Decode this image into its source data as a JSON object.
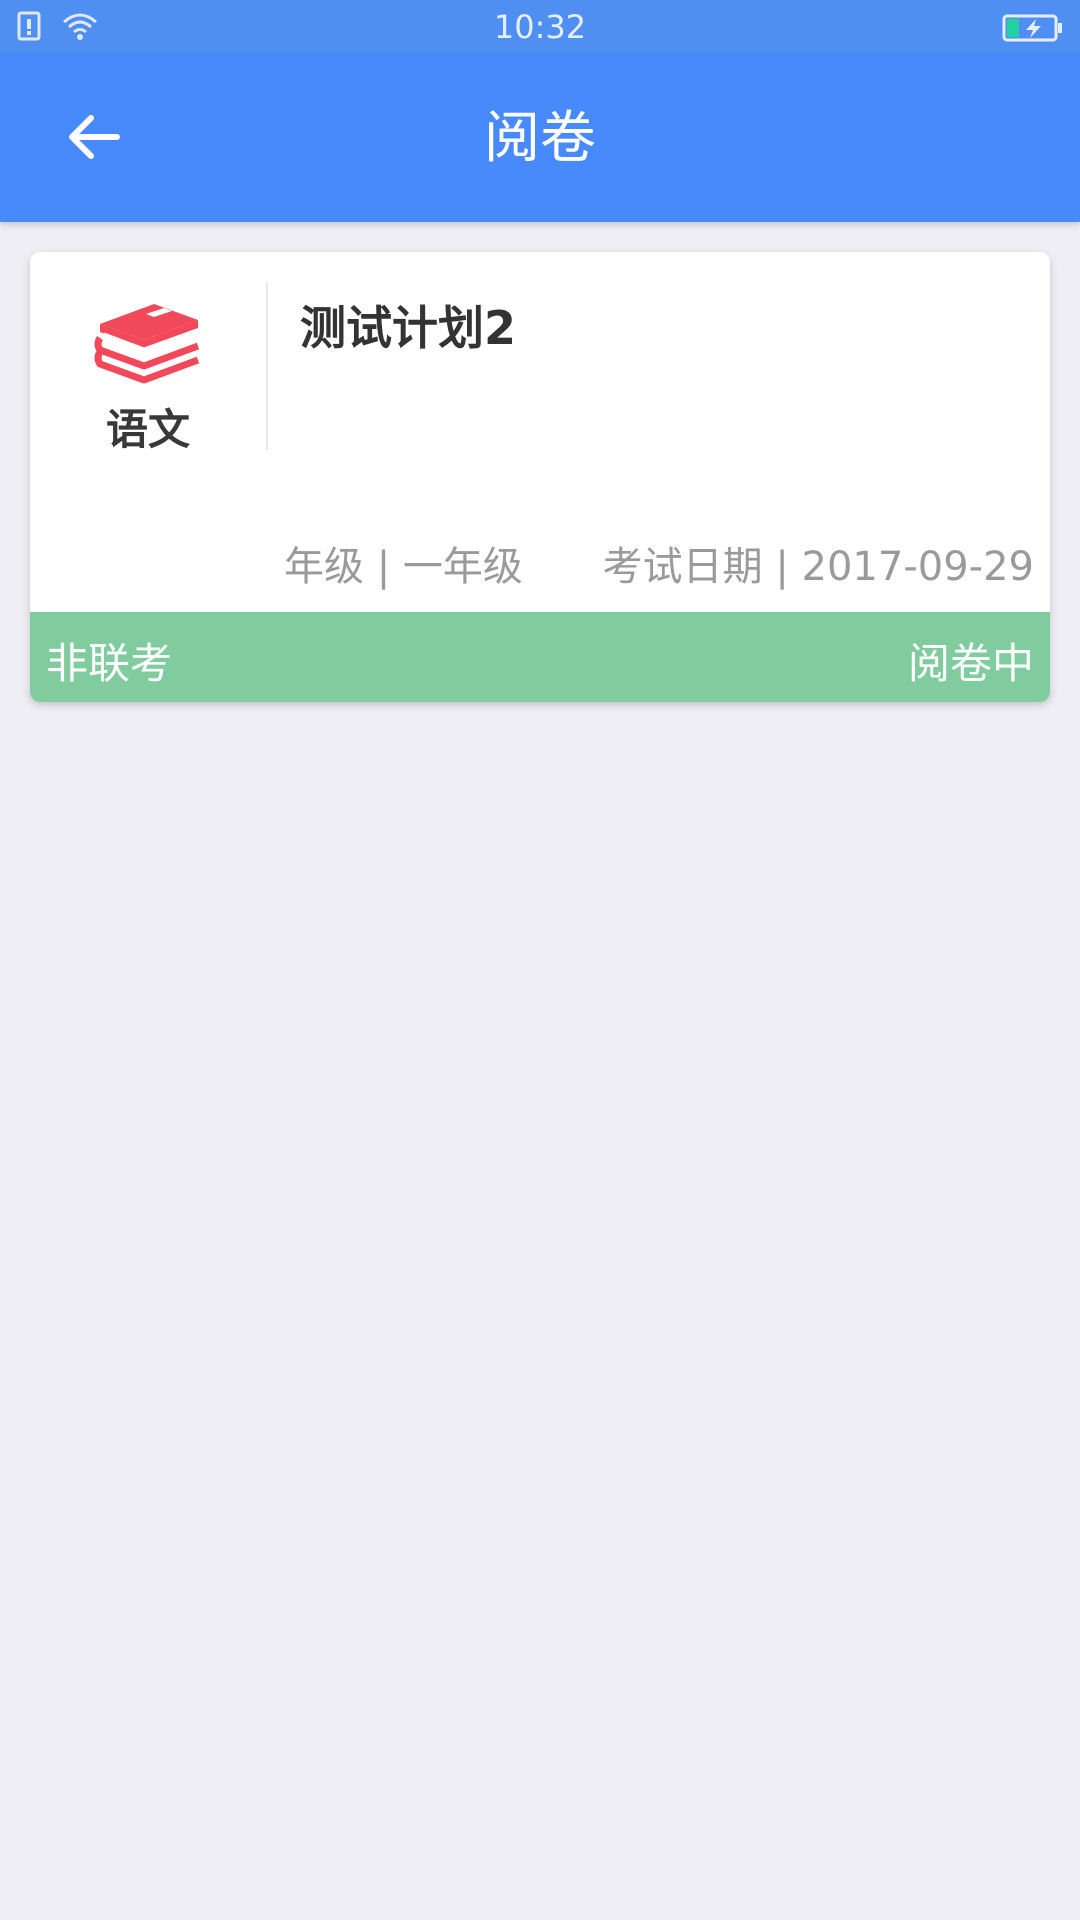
{
  "status_bar": {
    "time": "10:32",
    "icons": [
      "sim-alert-icon",
      "wifi-icon",
      "battery-charging-icon"
    ],
    "battery_color": "#22d3a0"
  },
  "app_bar": {
    "title": "阅卷",
    "back_icon": "arrow-left-icon",
    "background": "#488afb"
  },
  "exam_card": {
    "subject": "语文",
    "subject_icon": "book-stack-icon",
    "subject_icon_color": "#f2495a",
    "plan_title": "测试计划2",
    "grade": "年级 | 一年级",
    "exam_date": "考试日期 | 2017-09-29",
    "exam_type": "非联考",
    "status": "阅卷中",
    "footer_color": "#80cc9f"
  }
}
